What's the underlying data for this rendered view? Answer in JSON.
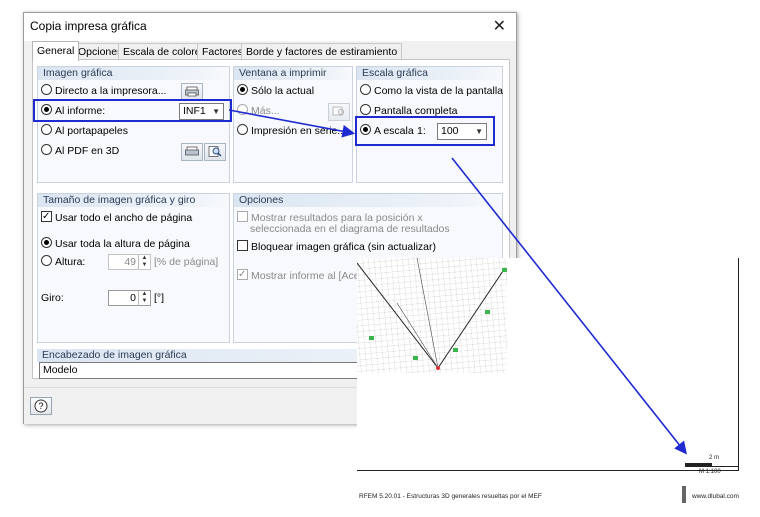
{
  "dialog": {
    "title": "Copia impresa gráfica",
    "close_glyph": "✕"
  },
  "tabs": [
    {
      "label": "General",
      "active": true
    },
    {
      "label": "Opciones",
      "active": false
    },
    {
      "label": "Escala de colores",
      "active": false
    },
    {
      "label": "Factores",
      "active": false
    },
    {
      "label": "Borde y factores de estiramiento",
      "active": false
    }
  ],
  "imagen_grafica": {
    "header": "Imagen gráfica",
    "directo": "Directo a la impresora...",
    "al_informe": "Al informe:",
    "informe_value": "INF1",
    "portapapeles": "Al portapapeles",
    "pdf": "Al PDF en 3D"
  },
  "ventana": {
    "header": "Ventana a imprimir",
    "solo_actual": "Sólo la actual",
    "mas": "Más...",
    "impresion_serie": "Impresión en serie..."
  },
  "escala": {
    "header": "Escala gráfica",
    "como_vista": "Como la vista de la pantalla",
    "pantalla_completa": "Pantalla completa",
    "a_escala": "A escala",
    "ratio_prefix": "1:",
    "ratio_value": "100"
  },
  "tamano": {
    "header": "Tamaño de imagen gráfica y giro",
    "ancho": "Usar todo el ancho de página",
    "altura_total": "Usar toda la altura de página",
    "altura": "Altura:",
    "altura_value": "49",
    "altura_unit": "[% de página]",
    "giro": "Giro:",
    "giro_value": "0",
    "giro_unit": "[°]"
  },
  "opciones": {
    "header": "Opciones",
    "mostrar_resultados_1": "Mostrar resultados para la posición x",
    "mostrar_resultados_2": "seleccionada en el diagrama de resultados",
    "bloquear": "Bloquear imagen gráfica (sin actualizar)",
    "mostrar_informe": "Mostrar informe al [Aceptar]"
  },
  "encabezado": {
    "header": "Encabezado de imagen gráfica",
    "value": "Modelo"
  },
  "help_glyph": "?",
  "preview": {
    "scale_length": "2 m",
    "scale_ratio": "M 1:100",
    "footer_left": "RFEM 5.20.01 - Estructuras 3D generales resueltas por el MEF",
    "footer_right": "www.dlubal.com"
  },
  "colors": {
    "highlight": "#1f2bd0",
    "group_header": "#dbe5f2"
  }
}
